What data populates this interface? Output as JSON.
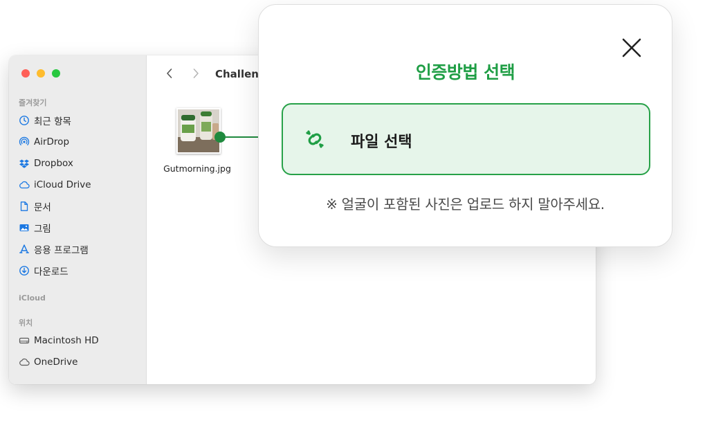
{
  "finder": {
    "sidebar": {
      "favorites_title": "즐겨찾기",
      "favorites": [
        {
          "label": "최근 항목",
          "icon": "clock-icon"
        },
        {
          "label": "AirDrop",
          "icon": "airdrop-icon"
        },
        {
          "label": "Dropbox",
          "icon": "dropbox-icon"
        },
        {
          "label": "iCloud Drive",
          "icon": "cloud-icon"
        },
        {
          "label": "문서",
          "icon": "document-icon"
        },
        {
          "label": "그림",
          "icon": "picture-icon"
        },
        {
          "label": "응용 프로그램",
          "icon": "applications-icon"
        },
        {
          "label": "다운로드",
          "icon": "download-icon"
        }
      ],
      "icloud_title": "iCloud",
      "locations_title": "위치",
      "locations": [
        {
          "label": "Macintosh HD",
          "icon": "harddrive-icon"
        },
        {
          "label": "OneDrive",
          "icon": "cloud-icon"
        }
      ]
    },
    "toolbar": {
      "folder_title": "Challen"
    },
    "files": [
      {
        "name": "Gutmorning.jpg"
      }
    ]
  },
  "modal": {
    "title": "인증방법 선택",
    "option_label": "파일 선택",
    "notice": "※ 얼굴이 포함된 사진은 업로드 하지 말아주세요."
  },
  "colors": {
    "accent_green": "#1f9e45",
    "option_bg": "#e6f5ea",
    "option_border": "#27a148"
  }
}
